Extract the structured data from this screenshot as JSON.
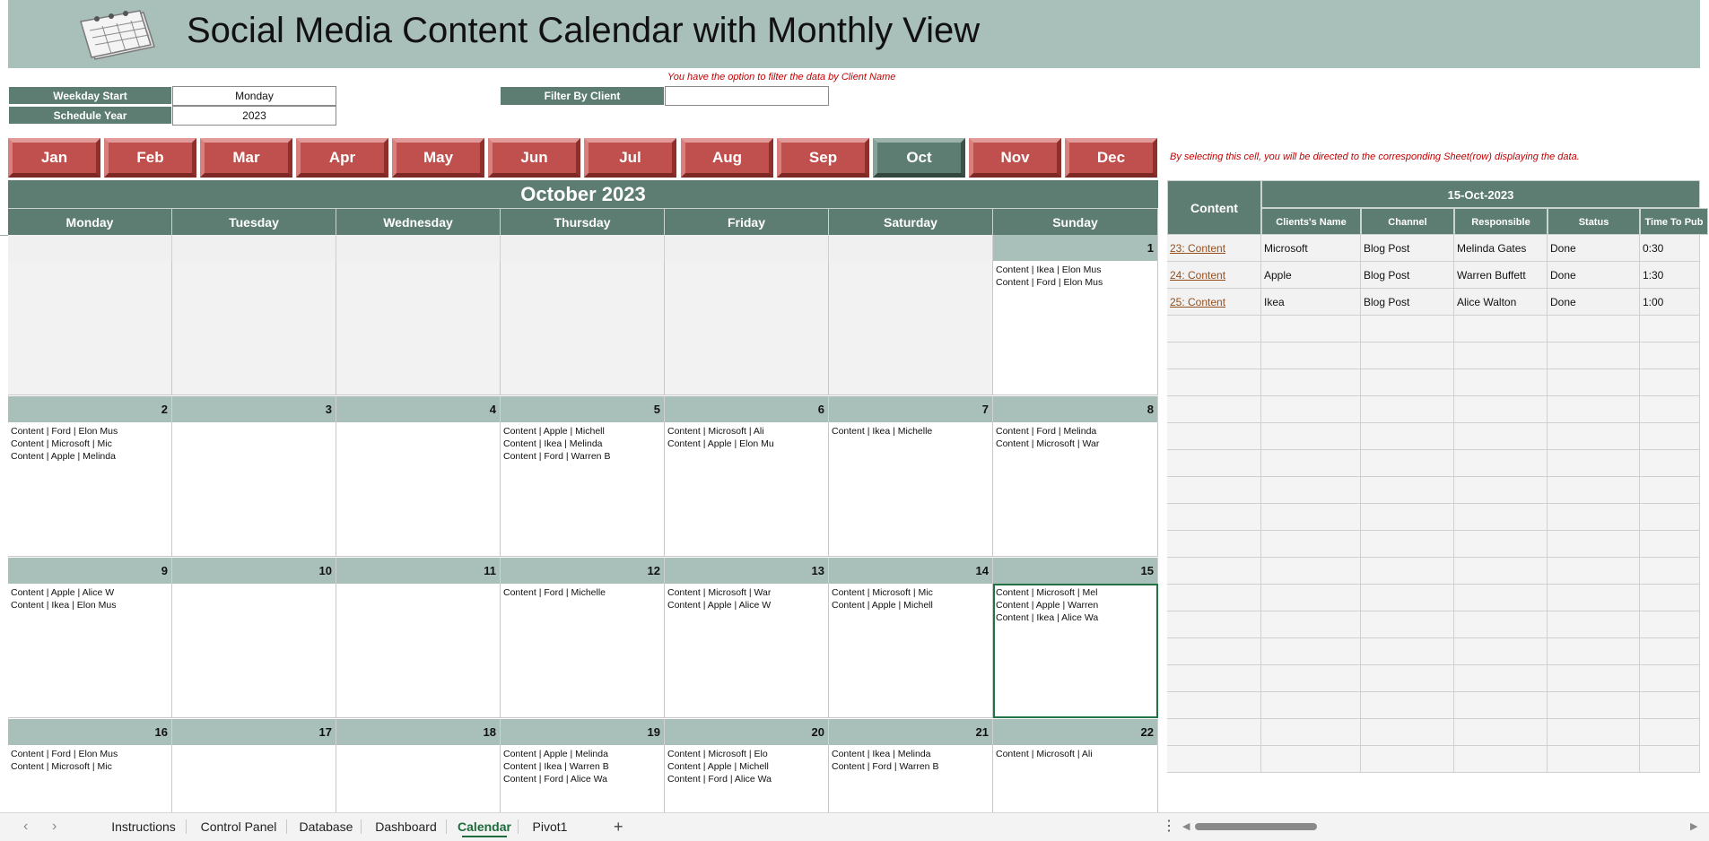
{
  "header": {
    "title": "Social Media Content Calendar with Monthly View"
  },
  "settings": {
    "weekday_start_label": "Weekday Start",
    "weekday_start_value": "Monday",
    "schedule_year_label": "Schedule Year",
    "schedule_year_value": "2023",
    "filter_label": "Filter By Client",
    "filter_value": "",
    "filter_note": "You have the option to filter the data by Client Name"
  },
  "months": [
    "Jan",
    "Feb",
    "Mar",
    "Apr",
    "May",
    "Jun",
    "Jul",
    "Aug",
    "Sep",
    "Oct",
    "Nov",
    "Dec"
  ],
  "active_month": "Oct",
  "selection_note": "By selecting this cell, you will be directed to the corresponding Sheet(row) displaying the data.",
  "calendar": {
    "title": "October 2023",
    "weekdays": [
      "Monday",
      "Tuesday",
      "Wednesday",
      "Thursday",
      "Friday",
      "Saturday",
      "Sunday"
    ],
    "weeks": [
      [
        {
          "day": "",
          "entries": []
        },
        {
          "day": "",
          "entries": []
        },
        {
          "day": "",
          "entries": []
        },
        {
          "day": "",
          "entries": []
        },
        {
          "day": "",
          "entries": []
        },
        {
          "day": "",
          "entries": []
        },
        {
          "day": "1",
          "entries": [
            "Content | Ikea | Elon Mus",
            "Content | Ford | Elon Mus"
          ]
        }
      ],
      [
        {
          "day": "2",
          "entries": [
            "Content | Ford | Elon Mus",
            "Content | Microsoft | Mic",
            "Content | Apple | Melinda"
          ]
        },
        {
          "day": "3",
          "entries": []
        },
        {
          "day": "4",
          "entries": []
        },
        {
          "day": "5",
          "entries": [
            "Content | Apple | Michell",
            "Content | Ikea | Melinda",
            "Content | Ford | Warren B"
          ]
        },
        {
          "day": "6",
          "entries": [
            "Content | Microsoft | Ali",
            "Content | Apple | Elon Mu"
          ]
        },
        {
          "day": "7",
          "entries": [
            "Content | Ikea | Michelle"
          ]
        },
        {
          "day": "8",
          "entries": [
            "Content | Ford | Melinda",
            "Content | Microsoft | War"
          ]
        }
      ],
      [
        {
          "day": "9",
          "entries": [
            "Content | Apple | Alice W",
            "Content | Ikea | Elon Mus"
          ]
        },
        {
          "day": "10",
          "entries": []
        },
        {
          "day": "11",
          "entries": []
        },
        {
          "day": "12",
          "entries": [
            "Content | Ford | Michelle"
          ]
        },
        {
          "day": "13",
          "entries": [
            "Content | Microsoft | War",
            "Content | Apple | Alice W"
          ]
        },
        {
          "day": "14",
          "entries": [
            "Content | Microsoft | Mic",
            "Content | Apple | Michell"
          ]
        },
        {
          "day": "15",
          "entries": [
            "Content | Microsoft | Mel",
            "Content | Apple | Warren",
            "Content | Ikea | Alice Wa"
          ]
        }
      ],
      [
        {
          "day": "16",
          "entries": [
            "Content | Ford | Elon Mus",
            "Content | Microsoft | Mic"
          ]
        },
        {
          "day": "17",
          "entries": []
        },
        {
          "day": "18",
          "entries": []
        },
        {
          "day": "19",
          "entries": [
            "Content | Apple | Melinda",
            "Content | Ikea | Warren B",
            "Content | Ford | Alice Wa"
          ]
        },
        {
          "day": "20",
          "entries": [
            "Content | Microsoft | Elo",
            "Content | Apple | Michell",
            "Content | Ford | Alice Wa"
          ]
        },
        {
          "day": "21",
          "entries": [
            "Content | Ikea | Melinda",
            "Content | Ford | Warren B"
          ]
        },
        {
          "day": "22",
          "entries": [
            "Content | Microsoft | Ali"
          ]
        }
      ]
    ],
    "selected_day": "15"
  },
  "detail_table": {
    "content_header": "Content",
    "date_header": "15-Oct-2023",
    "columns": [
      "Clients's Name",
      "Channel",
      "Responsible",
      "Status",
      "Time To Pub"
    ],
    "rows": [
      {
        "content": "23: Content",
        "client": "Microsoft",
        "channel": "Blog Post",
        "responsible": "Melinda Gates",
        "status": "Done",
        "time": "0:30"
      },
      {
        "content": "24: Content",
        "client": "Apple",
        "channel": "Blog Post",
        "responsible": "Warren Buffett",
        "status": "Done",
        "time": "1:30"
      },
      {
        "content": "25: Content",
        "client": "Ikea",
        "channel": "Blog Post",
        "responsible": "Alice Walton",
        "status": "Done",
        "time": "1:00"
      }
    ]
  },
  "sheet_tabs": [
    "Instructions",
    "Control Panel",
    "Database",
    "Dashboard",
    "Calendar",
    "Pivot1"
  ],
  "active_sheet": "Calendar",
  "colors": {
    "header_green": "#5e7d72",
    "banner_green": "#a9bfb9",
    "month_red": "#c0504d",
    "note_red": "#c00000"
  }
}
